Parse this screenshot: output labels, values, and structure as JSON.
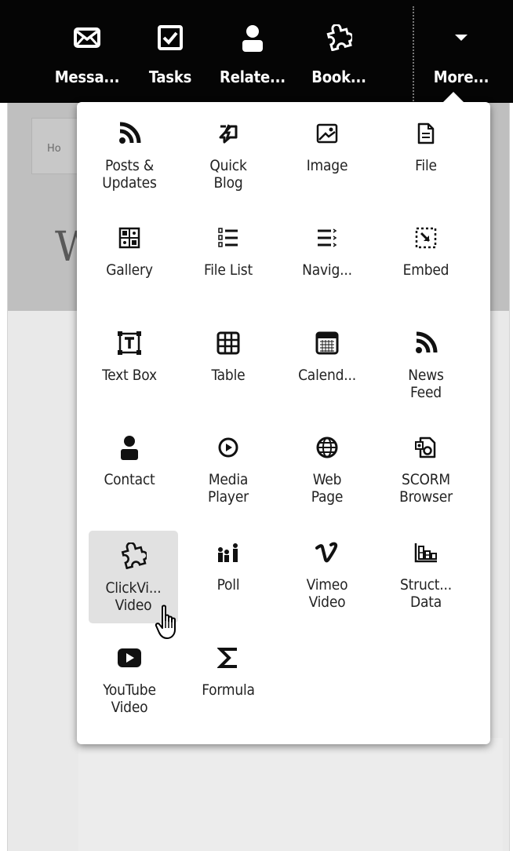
{
  "background": {
    "tab_label": "Ho",
    "heading_letter": "W"
  },
  "toolbar": {
    "items": [
      {
        "label": "Messa...",
        "icon": "envelope-icon"
      },
      {
        "label": "Tasks",
        "icon": "checkbox-icon"
      },
      {
        "label": "Relate...",
        "icon": "person-icon"
      },
      {
        "label": "Book...",
        "icon": "puzzle-icon"
      },
      {
        "label": "More...",
        "icon": "caret-down-icon"
      }
    ]
  },
  "menu": {
    "items": [
      {
        "label": "Posts &\nUpdates",
        "icon": "rss-icon"
      },
      {
        "label": "Quick\nBlog",
        "icon": "quick-blog-icon"
      },
      {
        "label": "Image",
        "icon": "image-icon"
      },
      {
        "label": "File",
        "icon": "file-icon"
      },
      {
        "label": "Gallery",
        "icon": "gallery-icon"
      },
      {
        "label": "File List",
        "icon": "file-list-icon"
      },
      {
        "label": "Navig...",
        "icon": "navigation-icon"
      },
      {
        "label": "Embed",
        "icon": "embed-icon"
      },
      {
        "label": "Text Box",
        "icon": "text-box-icon"
      },
      {
        "label": "Table",
        "icon": "table-icon"
      },
      {
        "label": "Calend...",
        "icon": "calendar-icon"
      },
      {
        "label": "News\nFeed",
        "icon": "news-feed-icon"
      },
      {
        "label": "Contact",
        "icon": "contact-icon"
      },
      {
        "label": "Media\nPlayer",
        "icon": "media-player-icon"
      },
      {
        "label": "Web\nPage",
        "icon": "globe-icon"
      },
      {
        "label": "SCORM\nBrowser",
        "icon": "scorm-icon"
      },
      {
        "label": "ClickVi...\nVideo",
        "icon": "puzzle-icon",
        "hovered": true
      },
      {
        "label": "Poll",
        "icon": "poll-icon"
      },
      {
        "label": "Vimeo\nVideo",
        "icon": "vimeo-icon"
      },
      {
        "label": "Struct...\nData",
        "icon": "structured-data-icon"
      },
      {
        "label": "YouTube\nVideo",
        "icon": "youtube-icon"
      },
      {
        "label": "Formula",
        "icon": "sigma-icon"
      }
    ]
  },
  "colors": {
    "toolbar_bg": "#050505",
    "hover_bg": "#e1e1e1",
    "icon": "#111111"
  }
}
